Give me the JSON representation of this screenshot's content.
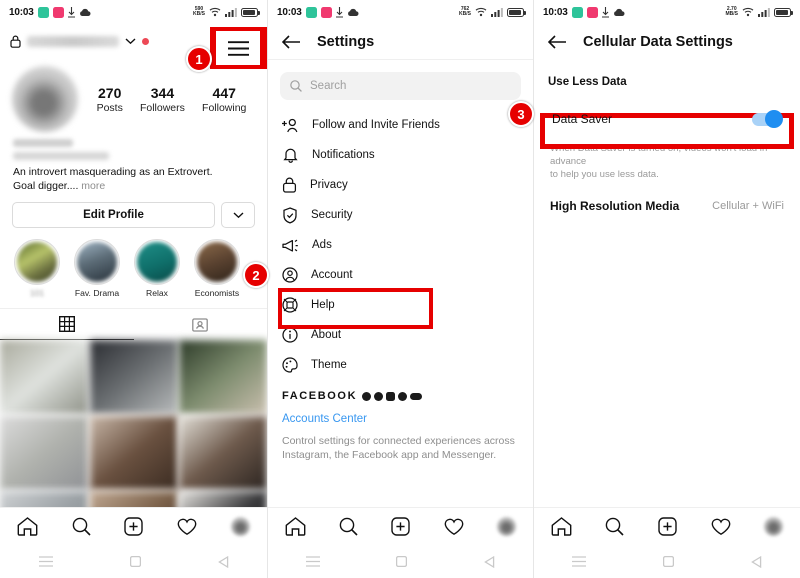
{
  "status_bar": {
    "time": "10:03",
    "net_speed_top": "590",
    "net_speed_bottom": "KB/S",
    "net_speed_p2_top": "762",
    "net_speed_p3_top": "2.70",
    "net_speed_p3_bottom": "MB/S"
  },
  "panel1": {
    "username_private": true,
    "stats": [
      {
        "num": "270",
        "label": "Posts"
      },
      {
        "num": "344",
        "label": "Followers"
      },
      {
        "num": "447",
        "label": "Following"
      }
    ],
    "bio_line1": "An introvert masquerading as an Extrovert.",
    "bio_line2": "Goal digger....",
    "bio_more": "more",
    "edit_profile": "Edit Profile",
    "highlights": [
      {
        "caption": "101"
      },
      {
        "caption": "Fav. Drama"
      },
      {
        "caption": "Relax"
      },
      {
        "caption": "Economists"
      }
    ]
  },
  "panel2": {
    "title": "Settings",
    "search_placeholder": "Search",
    "menu": [
      {
        "label": "Follow and Invite Friends",
        "icon": "add-person-icon"
      },
      {
        "label": "Notifications",
        "icon": "bell-icon"
      },
      {
        "label": "Privacy",
        "icon": "lock-icon"
      },
      {
        "label": "Security",
        "icon": "shield-check-icon"
      },
      {
        "label": "Ads",
        "icon": "megaphone-icon"
      },
      {
        "label": "Account",
        "icon": "account-circle-icon"
      },
      {
        "label": "Help",
        "icon": "help-icon"
      },
      {
        "label": "About",
        "icon": "info-icon"
      },
      {
        "label": "Theme",
        "icon": "palette-icon"
      }
    ],
    "facebook_title": "FACEBOOK",
    "accounts_center": "Accounts Center",
    "fb_desc_line1": "Control settings for connected experiences across",
    "fb_desc_line2": "Instagram, the Facebook app and Messenger."
  },
  "panel3": {
    "title": "Cellular Data Settings",
    "section_title": "Use Less Data",
    "data_saver_label": "Data Saver",
    "data_saver_on": true,
    "data_saver_desc_line1": "When Data Saver is turned on, videos won't load in advance",
    "data_saver_desc_line2": "to help you use less data.",
    "high_res_label": "High Resolution Media",
    "high_res_value": "Cellular + WiFi"
  },
  "badges": {
    "one": "1",
    "two": "2",
    "three": "3"
  },
  "colors": {
    "highlight_red": "#e60000",
    "toggle_blue": "#1f8ef1",
    "link_blue": "#3897f0"
  }
}
